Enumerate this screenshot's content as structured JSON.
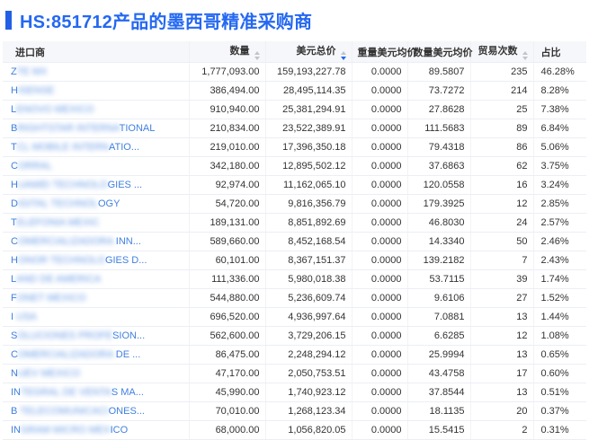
{
  "title": "HS:851712产品的墨西哥精准采购商",
  "colors": {
    "accent_blue": "#2468F2",
    "link_blue": "#4080E0",
    "header_bg": "#F6F7FA"
  },
  "table": {
    "columns": [
      {
        "label": "进口商",
        "sortable": false,
        "align": "left"
      },
      {
        "label": "数量",
        "sortable": true,
        "align": "right",
        "sort_state": "none"
      },
      {
        "label": "美元总价",
        "sortable": true,
        "align": "right",
        "sort_state": "desc"
      },
      {
        "label": "重量美元均价",
        "sortable": false,
        "align": "right"
      },
      {
        "label": "数量美元均价",
        "sortable": false,
        "align": "right"
      },
      {
        "label": "贸易次数",
        "sortable": true,
        "align": "right",
        "sort_state": "none"
      },
      {
        "label": "占比",
        "sortable": false,
        "align": "left"
      }
    ],
    "rows": [
      {
        "name": {
          "prefix": "Z",
          "blur": "TE MX",
          "suffix": ""
        },
        "qty": "1,777,093.00",
        "usd_total": "159,193,227.78",
        "weight_avg": "0.0000",
        "qty_avg": "89.5807",
        "trades": "235",
        "share": "46.28%"
      },
      {
        "name": {
          "prefix": "H",
          "blur": "ISENSE",
          "suffix": ""
        },
        "qty": "386,494.00",
        "usd_total": "28,495,114.35",
        "weight_avg": "0.0000",
        "qty_avg": "73.7272",
        "trades": "214",
        "share": "8.28%"
      },
      {
        "name": {
          "prefix": "L",
          "blur": "ENOVO MEXICO",
          "suffix": ""
        },
        "qty": "910,940.00",
        "usd_total": "25,381,294.91",
        "weight_avg": "0.0000",
        "qty_avg": "27.8628",
        "trades": "25",
        "share": "7.38%"
      },
      {
        "name": {
          "prefix": "B",
          "blur": "RIGHTSTAR INTERNA",
          "suffix": "TIONAL"
        },
        "qty": "210,834.00",
        "usd_total": "23,522,389.91",
        "weight_avg": "0.0000",
        "qty_avg": "111.5683",
        "trades": "89",
        "share": "6.84%"
      },
      {
        "name": {
          "prefix": "T",
          "blur": "CL MOBILE INTERN",
          "suffix": "ATIO..."
        },
        "qty": "219,010.00",
        "usd_total": "17,396,350.18",
        "weight_avg": "0.0000",
        "qty_avg": "79.4318",
        "trades": "86",
        "share": "5.06%"
      },
      {
        "name": {
          "prefix": "C",
          "blur": "ORRAL",
          "suffix": ""
        },
        "qty": "342,180.00",
        "usd_total": "12,895,502.12",
        "weight_avg": "0.0000",
        "qty_avg": "37.6863",
        "trades": "62",
        "share": "3.75%"
      },
      {
        "name": {
          "prefix": "H",
          "blur": "UAWEI TECHNOLO",
          "suffix": "GIES ..."
        },
        "qty": "92,974.00",
        "usd_total": "11,162,065.10",
        "weight_avg": "0.0000",
        "qty_avg": "120.0558",
        "trades": "16",
        "share": "3.24%"
      },
      {
        "name": {
          "prefix": "D",
          "blur": "IGITAL TECHNOL",
          "suffix": "OGY"
        },
        "qty": "54,720.00",
        "usd_total": "9,816,356.79",
        "weight_avg": "0.0000",
        "qty_avg": "179.3925",
        "trades": "12",
        "share": "2.85%"
      },
      {
        "name": {
          "prefix": "T",
          "blur": "ELEFONIA MEXIC",
          "suffix": ""
        },
        "qty": "189,131.00",
        "usd_total": "8,851,892.69",
        "weight_avg": "0.0000",
        "qty_avg": "46.8030",
        "trades": "24",
        "share": "2.57%"
      },
      {
        "name": {
          "prefix": "C",
          "blur": "OMERCIALIZADORA",
          "suffix": " INN..."
        },
        "qty": "589,660.00",
        "usd_total": "8,452,168.54",
        "weight_avg": "0.0000",
        "qty_avg": "14.3340",
        "trades": "50",
        "share": "2.46%"
      },
      {
        "name": {
          "prefix": "H",
          "blur": "ONOR TECHNOLO",
          "suffix": "GIES D..."
        },
        "qty": "60,101.00",
        "usd_total": "8,367,151.37",
        "weight_avg": "0.0000",
        "qty_avg": "139.2182",
        "trades": "7",
        "share": "2.43%"
      },
      {
        "name": {
          "prefix": "L",
          "blur": "AND DE AMERICA",
          "suffix": ""
        },
        "qty": "111,336.00",
        "usd_total": "5,980,018.38",
        "weight_avg": "0.0000",
        "qty_avg": "53.7115",
        "trades": "39",
        "share": "1.74%"
      },
      {
        "name": {
          "prefix": "F",
          "blur": "ONET MEXICO",
          "suffix": ""
        },
        "qty": "544,880.00",
        "usd_total": "5,236,609.74",
        "weight_avg": "0.0000",
        "qty_avg": "9.6106",
        "trades": "27",
        "share": "1.52%"
      },
      {
        "name": {
          "prefix": "I",
          "blur": " USA",
          "suffix": ""
        },
        "qty": "696,520.00",
        "usd_total": "4,936,997.64",
        "weight_avg": "0.0000",
        "qty_avg": "7.0881",
        "trades": "13",
        "share": "1.44%"
      },
      {
        "name": {
          "prefix": "S",
          "blur": "OLUCIONES PROFE",
          "suffix": "SION..."
        },
        "qty": "562,600.00",
        "usd_total": "3,729,206.15",
        "weight_avg": "0.0000",
        "qty_avg": "6.6285",
        "trades": "12",
        "share": "1.08%"
      },
      {
        "name": {
          "prefix": "C",
          "blur": "OMERCIALIZADORA",
          "suffix": " DE ..."
        },
        "qty": "86,475.00",
        "usd_total": "2,248,294.12",
        "weight_avg": "0.0000",
        "qty_avg": "25.9994",
        "trades": "13",
        "share": "0.65%"
      },
      {
        "name": {
          "prefix": "N",
          "blur": "UEV MEXICO",
          "suffix": ""
        },
        "qty": "47,170.00",
        "usd_total": "2,050,753.51",
        "weight_avg": "0.0000",
        "qty_avg": "43.4758",
        "trades": "17",
        "share": "0.60%"
      },
      {
        "name": {
          "prefix": "IN",
          "blur": "TEGRAL DE VENTA",
          "suffix": "S MA..."
        },
        "qty": "45,990.00",
        "usd_total": "1,740,923.12",
        "weight_avg": "0.0000",
        "qty_avg": "37.8544",
        "trades": "13",
        "share": "0.51%"
      },
      {
        "name": {
          "prefix": "B",
          "blur": " TELECOMUNICACI",
          "suffix": "ONES..."
        },
        "qty": "70,010.00",
        "usd_total": "1,268,123.34",
        "weight_avg": "0.0000",
        "qty_avg": "18.1135",
        "trades": "20",
        "share": "0.37%"
      },
      {
        "name": {
          "prefix": "IN",
          "blur": "GRAM MICRO MEX",
          "suffix": "ICO"
        },
        "qty": "68,000.00",
        "usd_total": "1,056,820.05",
        "weight_avg": "0.0000",
        "qty_avg": "15.5415",
        "trades": "2",
        "share": "0.31%"
      }
    ]
  }
}
